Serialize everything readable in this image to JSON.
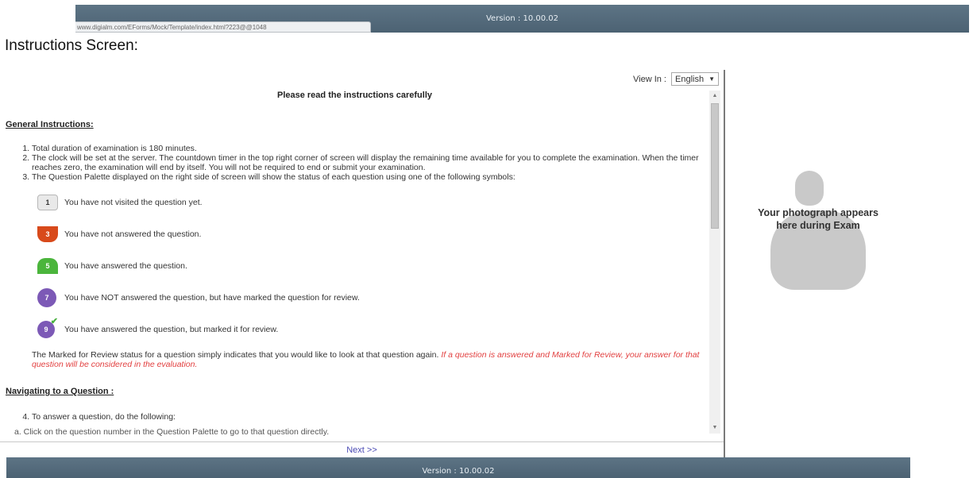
{
  "header": {
    "version": "Version : 10.00.02",
    "url_tooltip": "www.digialm.com/EForms/Mock/Template/index.html?223@@1048"
  },
  "screen_title": "Instructions Screen:",
  "view_in": {
    "label": "View In :",
    "selected_language": "English"
  },
  "content": {
    "title": "Please read the instructions carefully",
    "general_heading": "General Instructions:",
    "general_items": [
      "Total duration of examination is 180 minutes.",
      "The clock will be set at the server. The countdown timer in the top right corner of screen will display the remaining time available for you to complete the examination. When the timer reaches zero, the examination will end by itself. You will not be required to end or submit your examination.",
      "The Question Palette displayed on the right side of screen will show the status of each question using one of the following symbols:"
    ],
    "legend": [
      {
        "number": "1",
        "text": "You have not visited the question yet."
      },
      {
        "number": "3",
        "text": "You have not answered the question."
      },
      {
        "number": "5",
        "text": "You have answered the question."
      },
      {
        "number": "7",
        "text": "You have NOT answered the question, but have marked the question for review."
      },
      {
        "number": "9",
        "text": "You have answered the question, but marked it for review."
      }
    ],
    "review_note": "The Marked for Review status for a question simply indicates that you would like to look at that question again.",
    "review_note_red": "If a question is answered and Marked for Review, your answer for that question will be considered in the evaluation.",
    "navigating_heading": "Navigating to a Question :",
    "navigating_items": [
      "To answer a question, do the following:"
    ],
    "navigating_subitem": "a.   Click on the question number in the Question Palette to go to that question directly."
  },
  "next_label": "Next >>",
  "photo": {
    "caption": "Your photograph appears here during Exam"
  },
  "footer": {
    "version": "Version : 10.00.02"
  },
  "colors": {
    "header_bar": "#54697a",
    "not_answered": "#d84a1b",
    "answered": "#4bb53c",
    "marked": "#7c59b6",
    "red_note": "#e24040"
  }
}
